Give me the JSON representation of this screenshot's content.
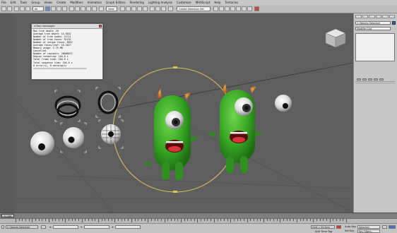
{
  "menu": [
    "File",
    "Edit",
    "Tools",
    "Group",
    "Views",
    "Create",
    "Modifiers",
    "Animation",
    "Graph Editors",
    "Rendering",
    "Lighting Analysis",
    "Customize",
    "MAXScript",
    "Help",
    "Tentacles"
  ],
  "toolbar": {
    "selection_filter": "All",
    "ref_coord": "View",
    "named_selection": "Create Selection Set"
  },
  "vray_window": {
    "title": "V-Ray messages",
    "lines": [
      "Max tree depth: 20",
      "Average tree depth: 14.5631",
      "Number of tree nodes: 21711",
      "Number of tree faces: 91192",
      "Number of unique faces: 8852",
      "Average faces/leaf: 10.3027",
      "Memory usage: 2.75 MB",
      "Cancelled",
      "Number of raycasts: 28008672",
      "Region rendering: 104.6 s",
      "Total frame time: 104.6 s",
      "Total sequence time: 104.6 s",
      "0 error(s), 0 warning(s)",
      "======================================"
    ]
  },
  "command_panel": {
    "name_field": "2 Objects Selected",
    "modifier_list": "Modifier List"
  },
  "timeline": {
    "frame": "0 / 100",
    "ruler_labels": [
      "0",
      "5",
      "10",
      "15",
      "20",
      "25",
      "30",
      "35",
      "40",
      "45",
      "50",
      "55",
      "60",
      "65",
      "70",
      "75",
      "80",
      "85",
      "90",
      "95",
      "100"
    ]
  },
  "status": {
    "selection": "2 Objects Selected",
    "x_label": "X:",
    "y_label": "Y:",
    "z_label": "Z:",
    "grid": "Grid = 25.4cm",
    "auto_key": "Auto Key",
    "auto_key_value": "Selected",
    "set_key": "Set Key",
    "key_filters": "Key Filters...",
    "add_time_tag": "Add Time Tag"
  },
  "viewcube_label": "TOP",
  "colors": {
    "viewport_bg": "#5e5e5e",
    "monster_green": "#3fa82b",
    "horn_orange": "#c26a1a",
    "selection_ring": "#d8c65a"
  }
}
